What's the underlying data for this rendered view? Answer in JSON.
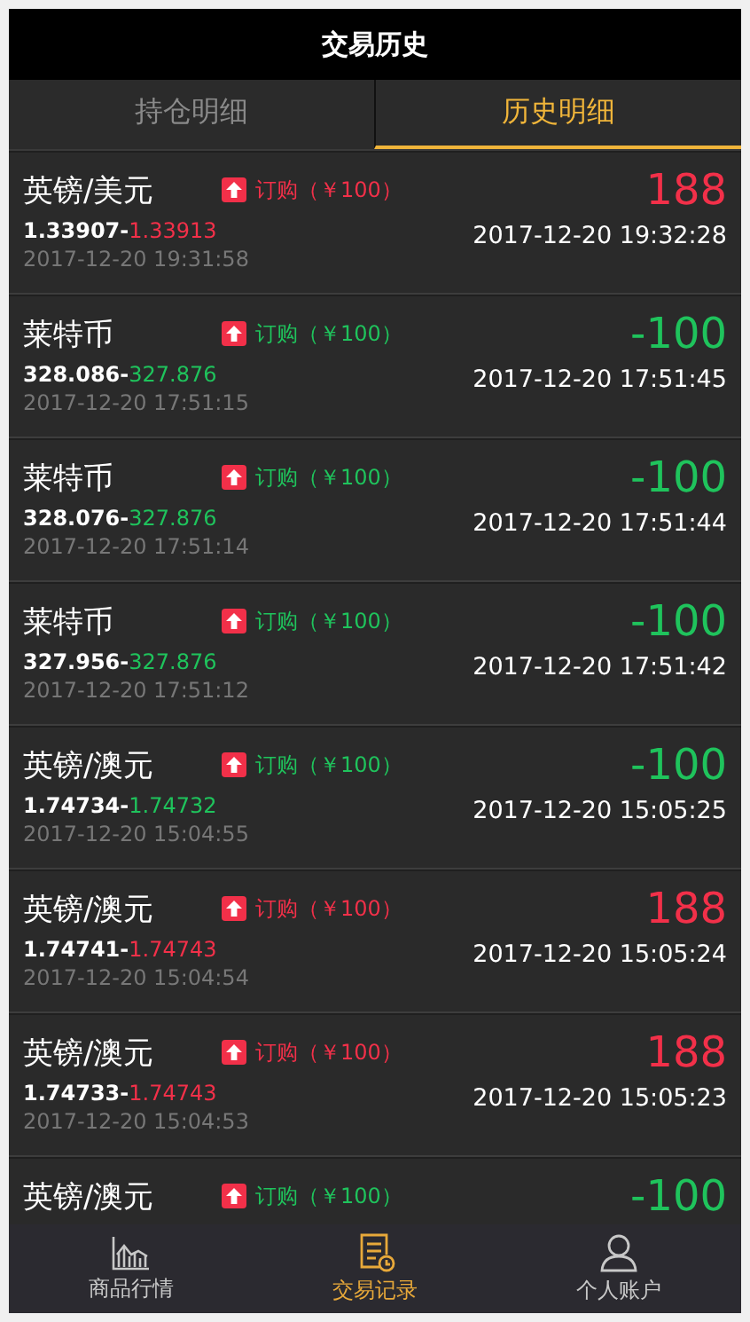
{
  "header": {
    "title": "交易历史"
  },
  "tabs": [
    {
      "label": "持仓明细",
      "selected": false
    },
    {
      "label": "历史明细",
      "selected": true
    }
  ],
  "trades": [
    {
      "name": "英镑/美元",
      "order": "订购（￥100）",
      "kind": "profit",
      "amount": "188",
      "open_price": "1.33907-",
      "close_price": "1.33913",
      "open_time": "2017-12-20 19:31:58",
      "close_time": "2017-12-20 19:32:28"
    },
    {
      "name": "莱特币",
      "order": "订购（￥100）",
      "kind": "loss",
      "amount": "-100",
      "open_price": "328.086-",
      "close_price": "327.876",
      "open_time": "2017-12-20 17:51:15",
      "close_time": "2017-12-20 17:51:45"
    },
    {
      "name": "莱特币",
      "order": "订购（￥100）",
      "kind": "loss",
      "amount": "-100",
      "open_price": "328.076-",
      "close_price": "327.876",
      "open_time": "2017-12-20 17:51:14",
      "close_time": "2017-12-20 17:51:44"
    },
    {
      "name": "莱特币",
      "order": "订购（￥100）",
      "kind": "loss",
      "amount": "-100",
      "open_price": "327.956-",
      "close_price": "327.876",
      "open_time": "2017-12-20 17:51:12",
      "close_time": "2017-12-20 17:51:42"
    },
    {
      "name": "英镑/澳元",
      "order": "订购（￥100）",
      "kind": "loss",
      "amount": "-100",
      "open_price": "1.74734-",
      "close_price": "1.74732",
      "open_time": "2017-12-20 15:04:55",
      "close_time": "2017-12-20 15:05:25"
    },
    {
      "name": "英镑/澳元",
      "order": "订购（￥100）",
      "kind": "profit",
      "amount": "188",
      "open_price": "1.74741-",
      "close_price": "1.74743",
      "open_time": "2017-12-20 15:04:54",
      "close_time": "2017-12-20 15:05:24"
    },
    {
      "name": "英镑/澳元",
      "order": "订购（￥100）",
      "kind": "profit",
      "amount": "188",
      "open_price": "1.74733-",
      "close_price": "1.74743",
      "open_time": "2017-12-20 15:04:53",
      "close_time": "2017-12-20 15:05:23"
    },
    {
      "name": "英镑/澳元",
      "order": "订购（￥100）",
      "kind": "loss",
      "amount": "-100"
    }
  ],
  "nav": [
    {
      "label": "商品行情",
      "kind": "chart",
      "selected": false
    },
    {
      "label": "交易记录",
      "kind": "record",
      "selected": true
    },
    {
      "label": "个人账户",
      "kind": "user",
      "selected": false
    }
  ]
}
